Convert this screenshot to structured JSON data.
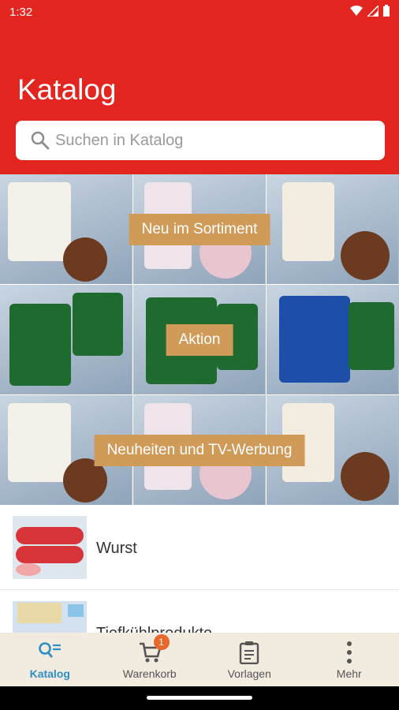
{
  "status": {
    "time": "1:32"
  },
  "header": {
    "title": "Katalog",
    "search_placeholder": "Suchen in Katalog"
  },
  "banners": [
    {
      "label": "Neu im Sortiment"
    },
    {
      "label": "Aktion"
    },
    {
      "label": "Neuheiten und TV-Werbung"
    }
  ],
  "categories": [
    {
      "label": "Wurst"
    },
    {
      "label": "Tiefkühlprodukte"
    }
  ],
  "nav": {
    "items": [
      {
        "label": "Katalog",
        "icon": "catalog-search-icon"
      },
      {
        "label": "Warenkorb",
        "icon": "cart-icon",
        "badge": "1"
      },
      {
        "label": "Vorlagen",
        "icon": "clipboard-icon"
      },
      {
        "label": "Mehr",
        "icon": "more-vert-icon"
      }
    ]
  },
  "colors": {
    "header": "#e3251f",
    "banner_label": "#d09a58",
    "active": "#2d8fc7",
    "badge": "#e8672a",
    "nav_bg": "#f2ebdf"
  }
}
